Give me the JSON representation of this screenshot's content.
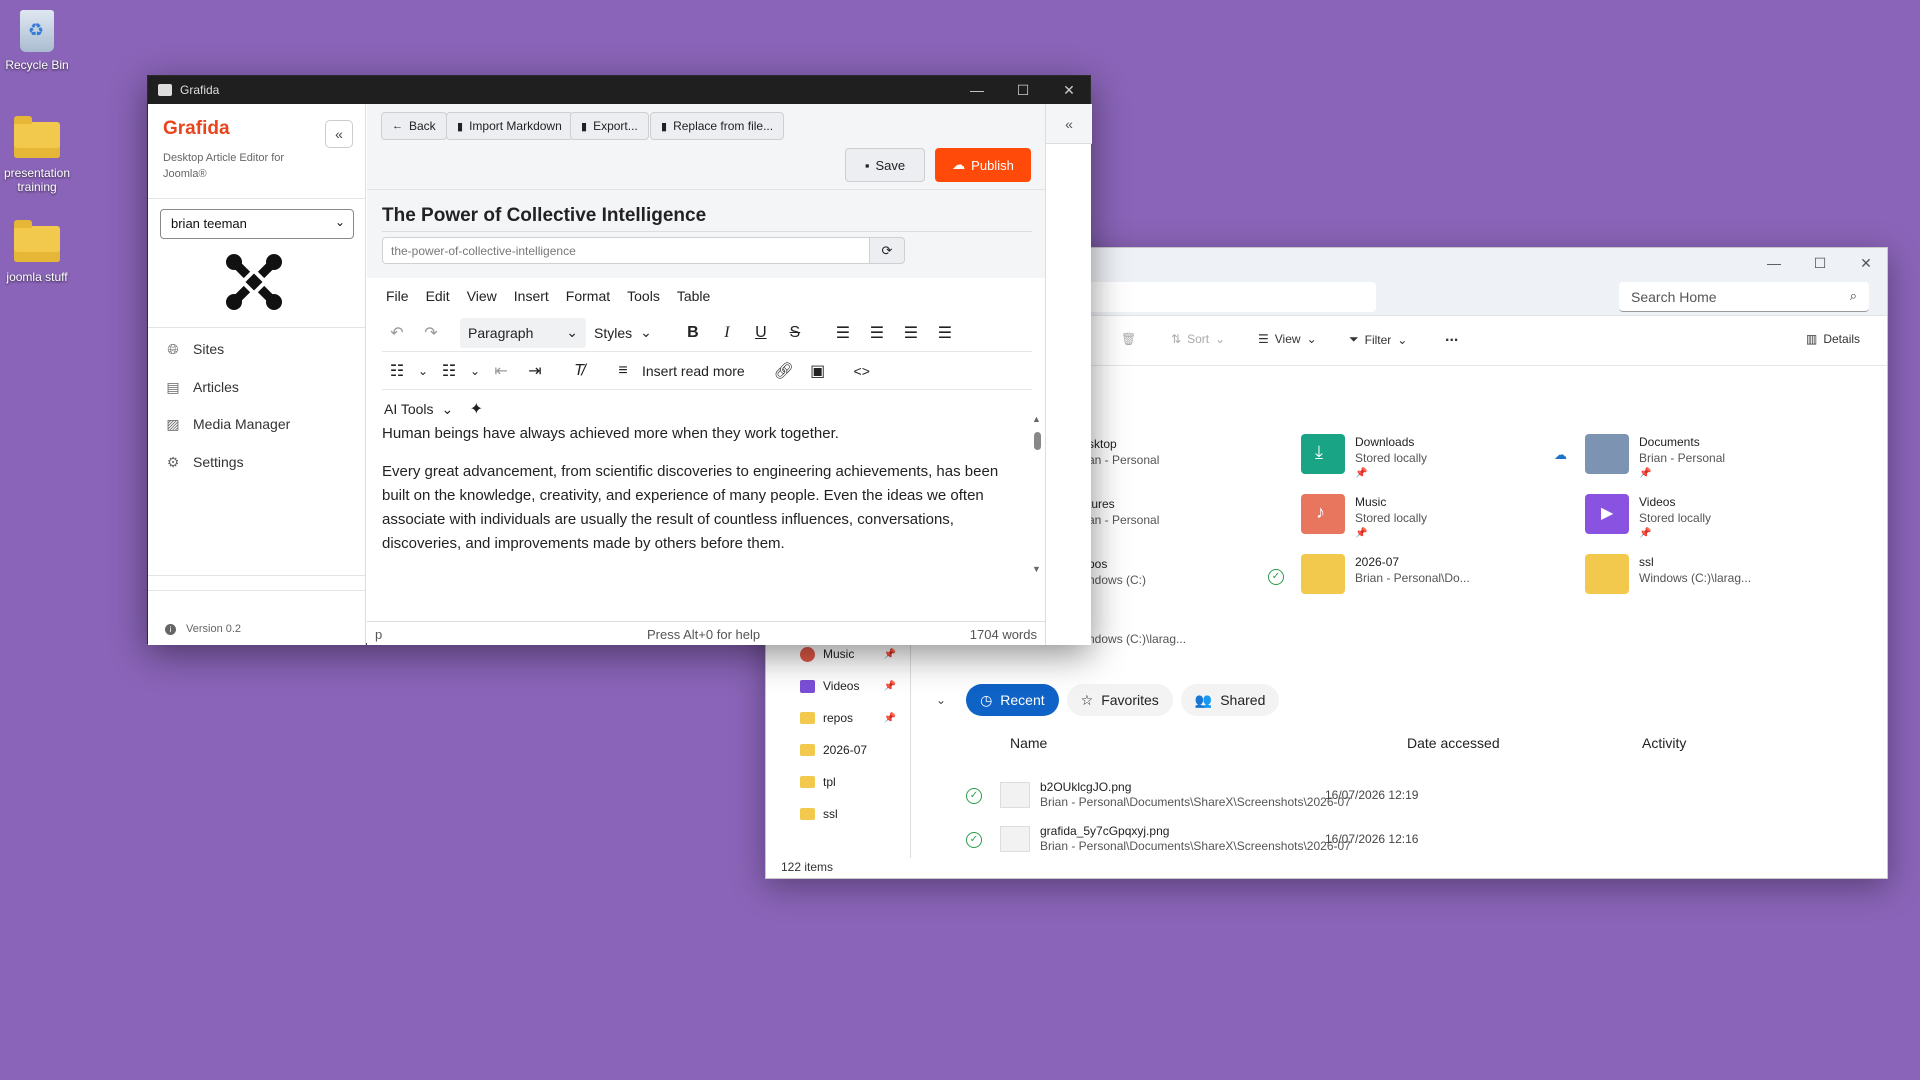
{
  "desktop": {
    "icons": [
      {
        "label": "Recycle Bin"
      },
      {
        "label": "presentation training"
      },
      {
        "label": "joomla stuff"
      }
    ]
  },
  "grafida": {
    "window_title": "Grafida",
    "brand": "Grafida",
    "brand_sub": "Desktop Article Editor for Joomla®",
    "user": "brian teeman",
    "nav": [
      {
        "label": "Sites",
        "icon": "globe-icon"
      },
      {
        "label": "Articles",
        "icon": "document-icon"
      },
      {
        "label": "Media Manager",
        "icon": "images-icon"
      },
      {
        "label": "Settings",
        "icon": "gear-icon"
      }
    ],
    "version": "Version 0.2",
    "header_buttons": {
      "back": "Back",
      "import": "Import Markdown",
      "export": "Export...",
      "replace": "Replace from file..."
    },
    "save_label": "Save",
    "publish_label": "Publish",
    "publish_color": "#ff4a0a",
    "article_title": "The Power of Collective Intelligence",
    "slug": "the-power-of-collective-intelligence",
    "menu": [
      "File",
      "Edit",
      "View",
      "Insert",
      "Format",
      "Tools",
      "Table"
    ],
    "block_format": "Paragraph",
    "styles_label": "Styles",
    "insert_read_more": "Insert read more",
    "ai_tools": "AI Tools",
    "content": [
      "Human beings have always achieved more when they work together.",
      "Every great advancement, from scientific discoveries to engineering achievements, has been built on the knowledge, creativity, and experience of many people. Even the ideas we often associate with individuals are usually the result of countless influences, conversations, discoveries, and improvements made by others before them."
    ],
    "status": {
      "path": "p",
      "help": "Press Alt+0 for help",
      "words": "1704 words"
    }
  },
  "explorer": {
    "search_placeholder": "Search Home",
    "toolbar": {
      "sort": "Sort",
      "view": "View",
      "filter": "Filter",
      "more": "...",
      "details": "Details"
    },
    "quick_access": [
      {
        "name": "sktop",
        "sub": "an - Personal"
      },
      {
        "name": "Downloads",
        "sub": "Stored locally"
      },
      {
        "name": "Documents",
        "sub": "Brian - Personal"
      },
      {
        "name": "tures",
        "sub": "an - Personal"
      },
      {
        "name": "Music",
        "sub": "Stored locally"
      },
      {
        "name": "Videos",
        "sub": "Stored locally"
      },
      {
        "name": "pos",
        "sub": "ndows (C:)"
      },
      {
        "name": "2026-07",
        "sub": "Brian - Personal\\Do..."
      },
      {
        "name": "ssl",
        "sub": "Windows (C:)\\larag..."
      },
      {
        "name": "",
        "sub": "ndows (C:)\\larag..."
      }
    ],
    "sidebar": [
      "Music",
      "Videos",
      "repos",
      "2026-07",
      "tpl",
      "ssl"
    ],
    "tabs": [
      "Recent",
      "Favorites",
      "Shared"
    ],
    "columns": [
      "Name",
      "Date accessed",
      "Activity"
    ],
    "files": [
      {
        "name": "b2OUklcgJO.png",
        "path": "Brian - Personal\\Documents\\ShareX\\Screenshots\\2026-07",
        "date": "16/07/2026 12:19"
      },
      {
        "name": "grafida_5y7cGpqxyj.png",
        "path": "Brian - Personal\\Documents\\ShareX\\Screenshots\\2026-07",
        "date": "16/07/2026 12:16"
      }
    ],
    "item_count": "122 items"
  }
}
